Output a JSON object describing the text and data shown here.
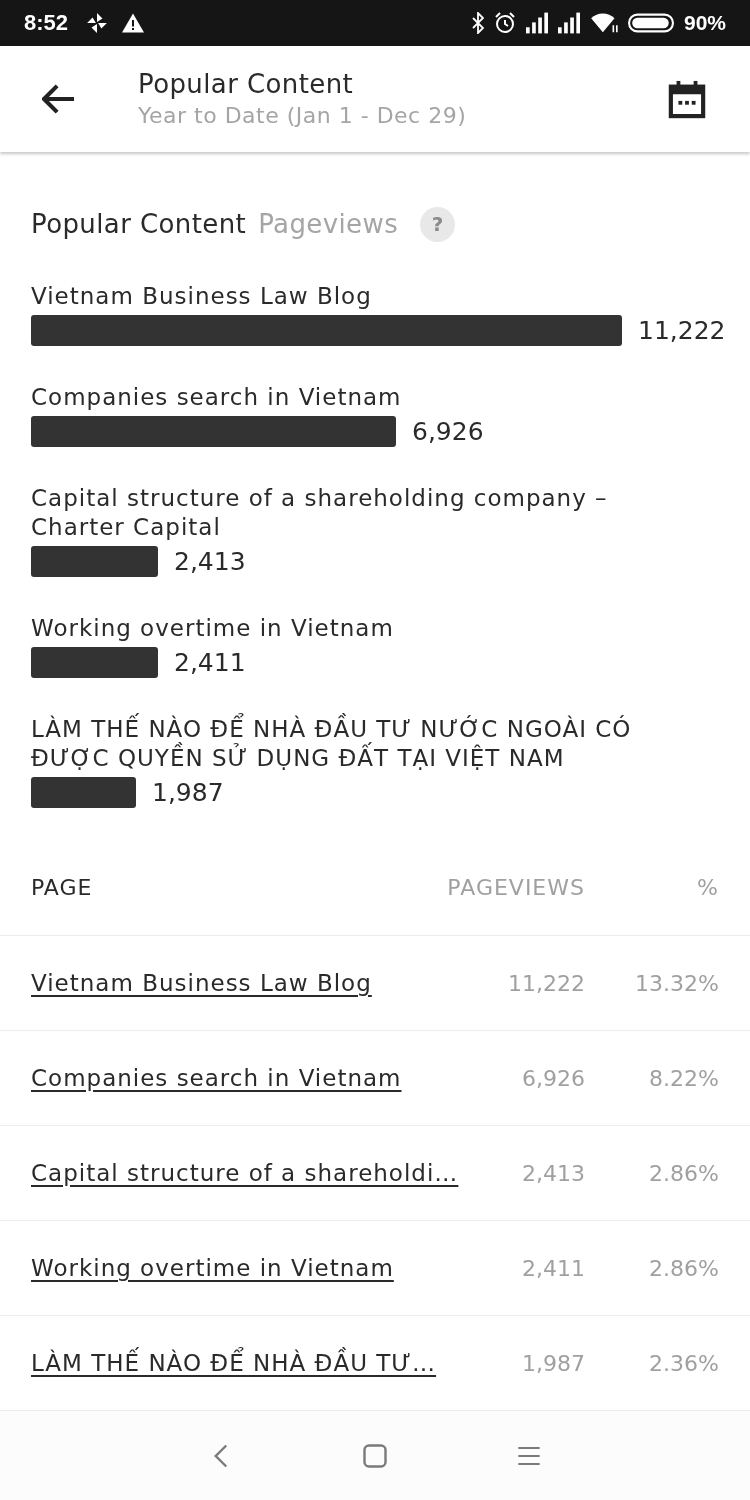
{
  "status_bar": {
    "time": "8:52",
    "battery": "90%"
  },
  "app_bar": {
    "title": "Popular Content",
    "subtitle": "Year to Date (Jan 1 - Dec 29)"
  },
  "section": {
    "title": "Popular Content",
    "metric": "Pageviews",
    "help": "?",
    "chart_data": {
      "type": "bar",
      "orientation": "horizontal",
      "categories": [
        "Vietnam Business Law Blog",
        "Companies search in Vietnam",
        "Capital structure of a shareholding company – Charter Capital",
        "Working overtime in Vietnam",
        "LÀM THẾ NÀO ĐỂ NHÀ ĐẦU TƯ NƯỚC NGOÀI CÓ ĐƯỢC QUYỀN SỬ DỤNG ĐẤT TẠI VIỆT NAM"
      ],
      "values": [
        11222,
        6926,
        2413,
        2411,
        1987
      ],
      "value_labels": [
        "11,222",
        "6,926",
        "2,413",
        "2,411",
        "1,987"
      ]
    }
  },
  "table": {
    "columns": [
      "PAGE",
      "PAGEVIEWS",
      "%"
    ],
    "rows": [
      {
        "page": "Vietnam Business Law Blog",
        "pageviews": "11,222",
        "percent": "13.32%"
      },
      {
        "page": "Companies search in Vietnam",
        "pageviews": "6,926",
        "percent": "8.22%"
      },
      {
        "page": "Capital structure of a shareholdi…",
        "pageviews": "2,413",
        "percent": "2.86%"
      },
      {
        "page": "Working overtime in Vietnam",
        "pageviews": "2,411",
        "percent": "2.86%"
      },
      {
        "page": "LÀM THẾ NÀO ĐỂ NHÀ ĐẦU TƯ…",
        "pageviews": "1,987",
        "percent": "2.36%"
      }
    ]
  }
}
